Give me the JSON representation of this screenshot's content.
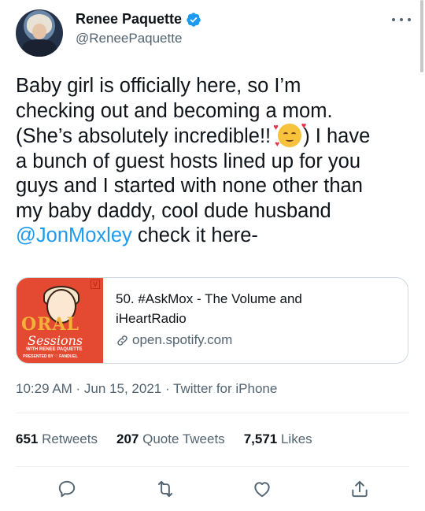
{
  "user": {
    "name": "Renee Paquette",
    "handle": "@ReneePaquette",
    "verified_icon": "verified-badge-icon"
  },
  "tweet": {
    "lines": [
      "Baby girl is officially here, so I’m",
      "checking out and becoming a mom.",
      "(She’s absolutely incredible!!",
      ") I have",
      "a bunch of guest hosts lined up for you",
      "guys and I started with none other than",
      "my baby daddy, cool dude husband",
      "@JonMoxley",
      " check it here-"
    ],
    "emoji": "smiling-face-with-hearts"
  },
  "card": {
    "title_line1": "50. #AskMox - The Volume and",
    "title_line2": "iHeartRadio",
    "domain": "open.spotify.com",
    "thumb": {
      "badge": "V",
      "word1": "ORAL",
      "word2": "Sessions",
      "tagline": "WITH RENEE PAQUETTE",
      "presented": "PRESENTED BY ♡ FANDUEL"
    }
  },
  "meta": "10:29 AM · Jun 15, 2021 · Twitter for iPhone",
  "stats": {
    "retweets_count": "651",
    "retweets_label": "Retweets",
    "quotes_count": "207",
    "quotes_label": "Quote Tweets",
    "likes_count": "7,571",
    "likes_label": "Likes"
  },
  "actions": [
    "reply-icon",
    "retweet-icon",
    "like-icon",
    "share-icon"
  ],
  "colors": {
    "accent": "#1d9bf0",
    "text": "#0f1419",
    "muted": "#536471",
    "border": "#cfd9de"
  }
}
